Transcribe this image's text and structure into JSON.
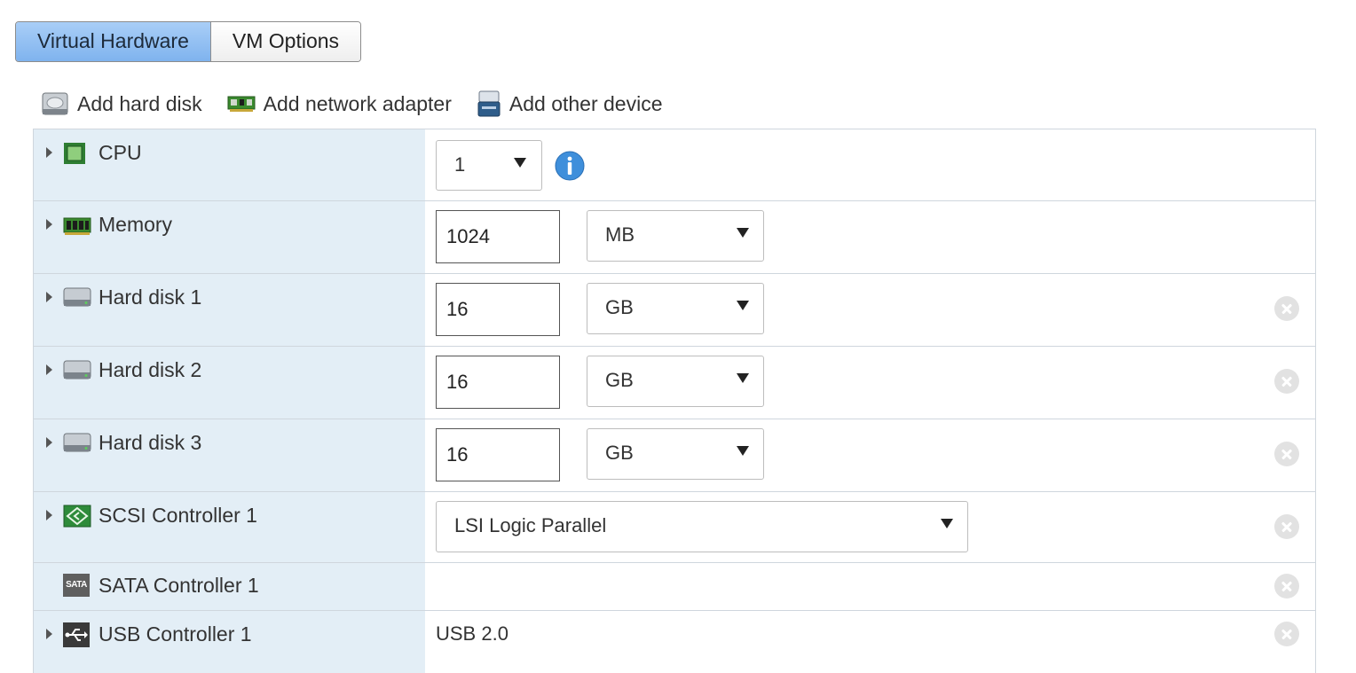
{
  "tabs": [
    "Virtual Hardware",
    "VM Options"
  ],
  "toolbar": {
    "add_hard_disk": "Add hard disk",
    "add_network_adapter": "Add network adapter",
    "add_other_device": "Add other device"
  },
  "devices": {
    "cpu": {
      "label": "CPU",
      "value": "1"
    },
    "memory": {
      "label": "Memory",
      "value": "1024",
      "unit": "MB"
    },
    "hard_disk_1": {
      "label": "Hard disk 1",
      "value": "16",
      "unit": "GB"
    },
    "hard_disk_2": {
      "label": "Hard disk 2",
      "value": "16",
      "unit": "GB"
    },
    "hard_disk_3": {
      "label": "Hard disk 3",
      "value": "16",
      "unit": "GB"
    },
    "scsi": {
      "label": "SCSI Controller 1",
      "value": "LSI Logic Parallel"
    },
    "sata": {
      "label": "SATA Controller 1",
      "icon_text": "SATA"
    },
    "usb": {
      "label": "USB Controller 1",
      "value": "USB 2.0"
    }
  },
  "colors": {
    "active_tab": "#7fb3ee",
    "label_column": "#e3eef6",
    "info": "#3f8fdb",
    "remove": "#e2e2e2"
  }
}
